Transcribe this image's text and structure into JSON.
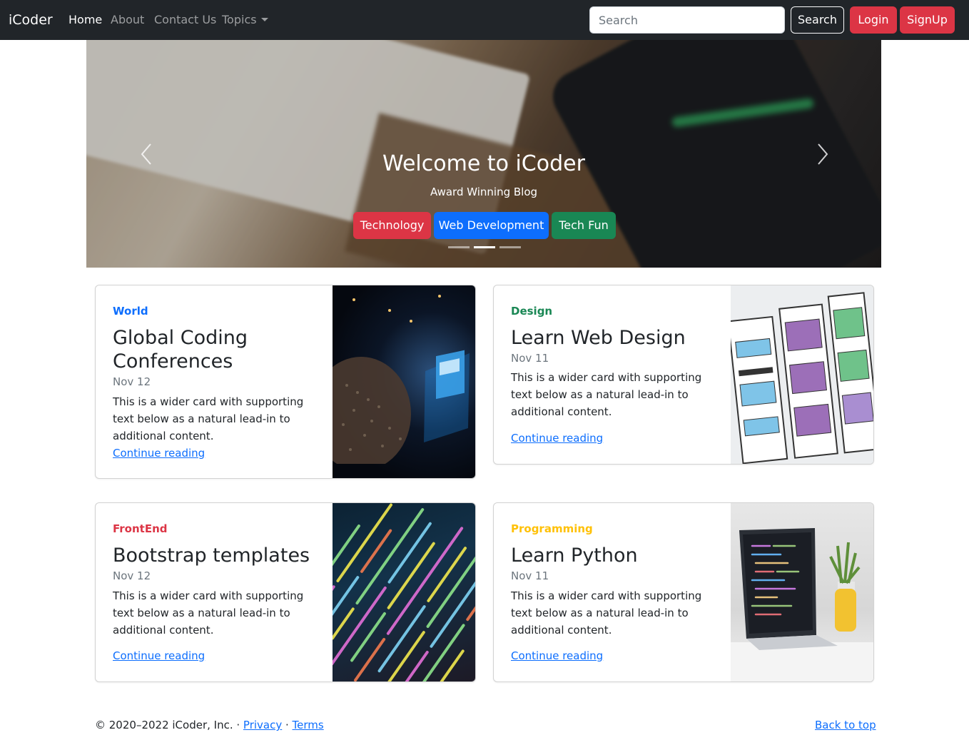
{
  "navbar": {
    "brand": "iCoder",
    "links": {
      "home": "Home",
      "about": "About",
      "contact": "Contact Us",
      "topics": "Topics"
    },
    "search_placeholder": "Search",
    "search_button": "Search",
    "login": "Login",
    "signup": "SignUp"
  },
  "hero": {
    "title": "Welcome to iCoder",
    "subtitle": "Award Winning Blog",
    "buttons": {
      "technology": "Technology",
      "webdev": "Web Development",
      "techfun": "Tech Fun"
    },
    "slides": 3,
    "active_slide": 2
  },
  "cards": [
    {
      "category": "World",
      "category_color": "#0d6efd",
      "title_line1": "Global Coding",
      "title_line2": "Conferences",
      "date": "Nov 12",
      "text": "This is a wider card with supporting text below as a natural lead-in to additional content.",
      "link": "Continue reading"
    },
    {
      "category": "Design",
      "category_color": "#198754",
      "title": "Learn Web Design",
      "date": "Nov 11",
      "text": "This is a wider card with supporting text below as a natural lead-in to additional content.",
      "link": "Continue reading"
    },
    {
      "category": "FrontEnd",
      "category_color": "#dc3545",
      "title": "Bootstrap templates",
      "date": "Nov 12",
      "text": "This is a wider card with supporting text below as a natural lead-in to additional content.",
      "link": "Continue reading"
    },
    {
      "category": "Programming",
      "category_color": "#ffc107",
      "title": "Learn Python",
      "date": "Nov 11",
      "text": "This is a wider card with supporting text below as a natural lead-in to additional content.",
      "link": "Continue reading"
    }
  ],
  "footer": {
    "copyright": "© 2020–2022 iCoder, Inc. · ",
    "privacy": "Privacy",
    "separator": " · ",
    "terms": "Terms",
    "back_to_top": "Back to top"
  }
}
